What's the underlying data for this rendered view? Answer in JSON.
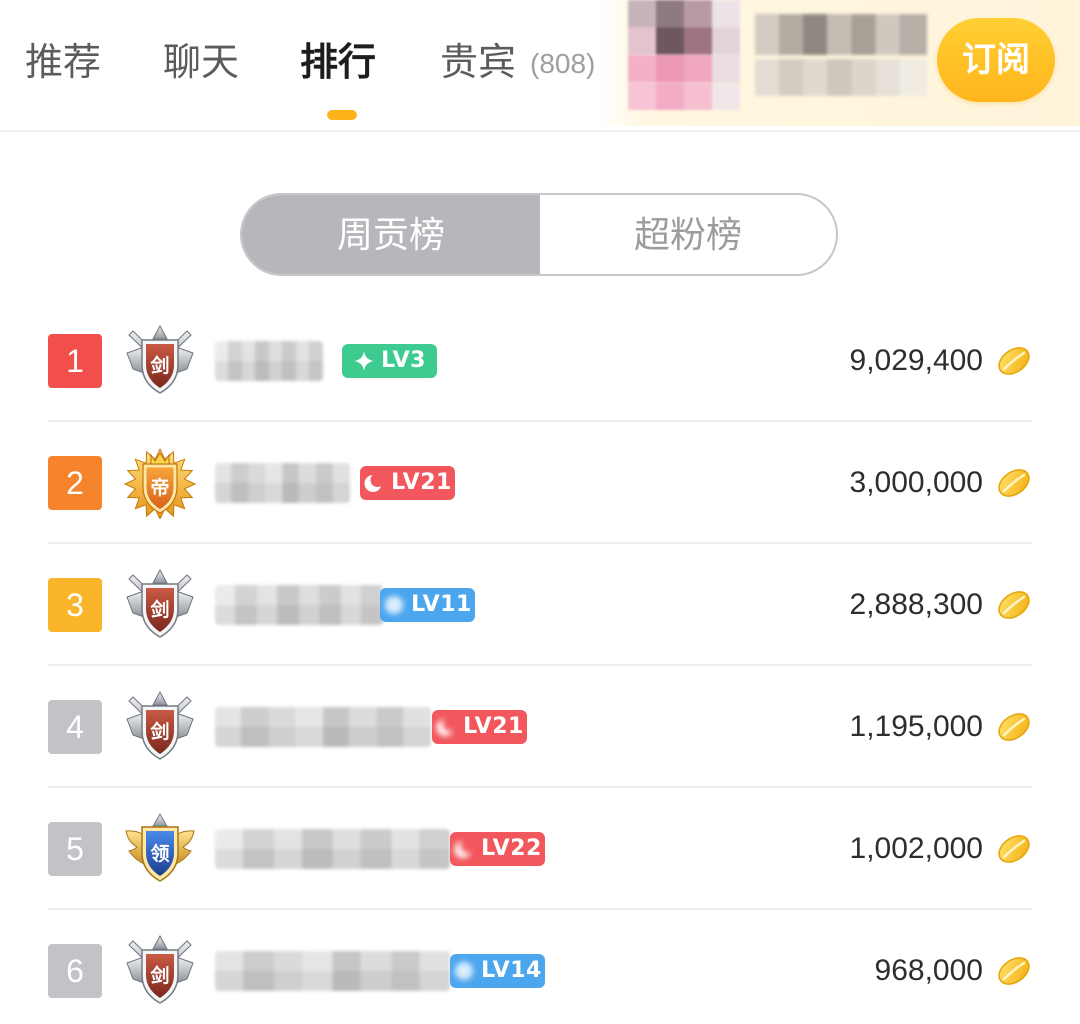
{
  "nav": {
    "tabs": [
      {
        "label": "推荐",
        "active": false
      },
      {
        "label": "聊天",
        "active": false
      },
      {
        "label": "排行",
        "active": true
      },
      {
        "label": "贵宾",
        "count": "(808)",
        "active": false
      }
    ],
    "subscribe_label": "订阅"
  },
  "leaderboard_tabs": [
    {
      "label": "周贡榜",
      "active": true
    },
    {
      "label": "超粉榜",
      "active": false
    }
  ],
  "ranking": [
    {
      "rank": "1",
      "rank_color": "#F24F4C",
      "emblem": {
        "icon": "sword-emblem-icon",
        "char": "剑"
      },
      "level": {
        "label": "LV3",
        "icon": "sparkle-icon",
        "color": "#3DCB8F"
      },
      "amount": "9,029,400",
      "currency_icon": "coin-icon"
    },
    {
      "rank": "2",
      "rank_color": "#F5842C",
      "emblem": {
        "icon": "emperor-emblem-icon",
        "char": "帝"
      },
      "level": {
        "label": "LV21",
        "icon": "moon-icon",
        "color": "#F2575D"
      },
      "amount": "3,000,000",
      "currency_icon": "coin-icon"
    },
    {
      "rank": "3",
      "rank_color": "#FBB52A",
      "emblem": {
        "icon": "sword-emblem-icon",
        "char": "剑"
      },
      "level": {
        "label": "LV11",
        "icon": "level-icon",
        "color": "#4CA6EE"
      },
      "amount": "2,888,300",
      "currency_icon": "coin-icon"
    },
    {
      "rank": "4",
      "rank_color": "#C3C3C7",
      "emblem": {
        "icon": "sword-emblem-icon",
        "char": "剑"
      },
      "level": {
        "label": "LV21",
        "icon": "moon-icon",
        "color": "#F2575D"
      },
      "amount": "1,195,000",
      "currency_icon": "coin-icon"
    },
    {
      "rank": "5",
      "rank_color": "#C3C3C7",
      "emblem": {
        "icon": "leader-emblem-icon",
        "char": "领"
      },
      "level": {
        "label": "LV22",
        "icon": "moon-icon",
        "color": "#F2575D"
      },
      "amount": "1,002,000",
      "currency_icon": "coin-icon"
    },
    {
      "rank": "6",
      "rank_color": "#C3C3C7",
      "emblem": {
        "icon": "sword-emblem-icon",
        "char": "剑"
      },
      "level": {
        "label": "LV14",
        "icon": "level-icon",
        "color": "#4CA6EE"
      },
      "amount": "968,000",
      "currency_icon": "coin-icon"
    }
  ],
  "colors": {
    "accent": "#FFB31A",
    "subscribe": "#FFBE22",
    "segment_active": "#B6B6BB"
  }
}
